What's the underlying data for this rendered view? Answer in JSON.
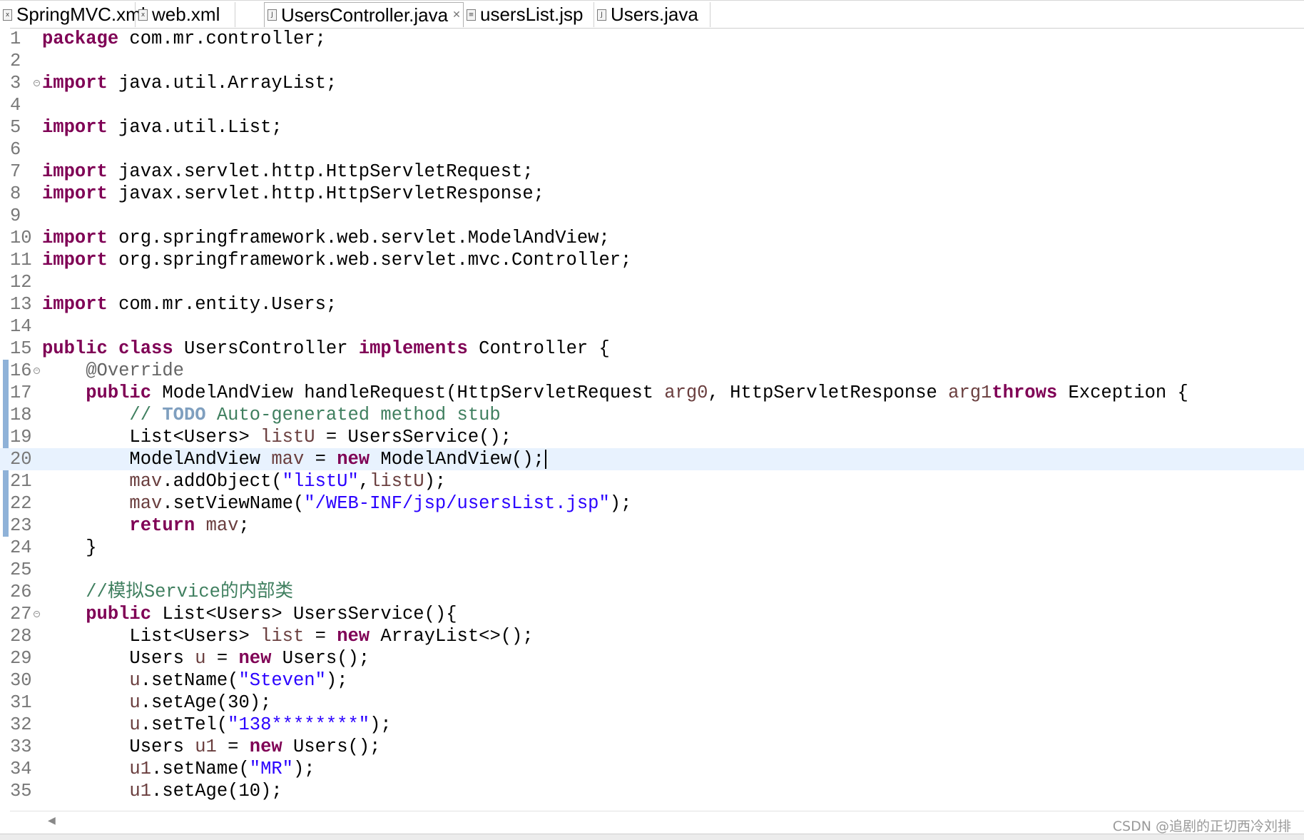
{
  "tabs": [
    {
      "label": "SpringMVC.xml",
      "icon": "xml-file-icon",
      "glyph": "x",
      "active": false
    },
    {
      "label": "web.xml",
      "icon": "xml-file-icon",
      "glyph": "x",
      "active": false
    },
    {
      "label": "UsersController.java",
      "icon": "java-file-icon",
      "glyph": "J",
      "active": true,
      "close": "✕"
    },
    {
      "label": "usersList.jsp",
      "icon": "jsp-file-icon",
      "glyph": "≡",
      "active": false
    },
    {
      "label": "Users.java",
      "icon": "java-file-icon",
      "glyph": "J",
      "active": false
    }
  ],
  "editor": {
    "current_line": 20,
    "lines": [
      {
        "n": "1",
        "tokens": [
          [
            "kw",
            "package"
          ],
          [
            "",
            "com.mr.controller;"
          ]
        ]
      },
      {
        "n": "2",
        "tokens": []
      },
      {
        "n": "3",
        "fold": true,
        "tokens": [
          [
            "kw",
            "import"
          ],
          [
            "",
            " java.util.ArrayList;"
          ]
        ]
      },
      {
        "n": "4",
        "tokens": []
      },
      {
        "n": "5",
        "tokens": [
          [
            "kw",
            "import"
          ],
          [
            "",
            " java.util.List;"
          ]
        ]
      },
      {
        "n": "6",
        "tokens": []
      },
      {
        "n": "7",
        "tokens": [
          [
            "kw",
            "import"
          ],
          [
            "",
            " javax.servlet.http.HttpServletRequest;"
          ]
        ]
      },
      {
        "n": "8",
        "tokens": [
          [
            "kw",
            "import"
          ],
          [
            "",
            " javax.servlet.http.HttpServletResponse;"
          ]
        ]
      },
      {
        "n": "9",
        "tokens": []
      },
      {
        "n": "10",
        "tokens": [
          [
            "kw",
            "import"
          ],
          [
            "",
            " org.springframework.web.servlet.ModelAndView;"
          ]
        ]
      },
      {
        "n": "11",
        "tokens": [
          [
            "kw",
            "import"
          ],
          [
            "",
            " org.springframework.web.servlet.mvc.Controller;"
          ]
        ]
      },
      {
        "n": "12",
        "tokens": []
      },
      {
        "n": "13",
        "tokens": [
          [
            "kw",
            "import"
          ],
          [
            "",
            " com.mr.entity.Users;"
          ]
        ]
      },
      {
        "n": "14",
        "tokens": []
      },
      {
        "n": "15",
        "tokens": [
          [
            "kw",
            "public"
          ],
          [
            "",
            " "
          ],
          [
            "kw",
            "class"
          ],
          [
            "",
            " UsersController "
          ],
          [
            "kw",
            "implements"
          ],
          [
            "",
            " Controller {"
          ]
        ]
      },
      {
        "n": "16",
        "fold": true,
        "tokens": [
          [
            "",
            "    "
          ],
          [
            "ann",
            "@Override"
          ]
        ]
      },
      {
        "n": "17",
        "tokens": [
          [
            "",
            "    "
          ],
          [
            "kw",
            "public"
          ],
          [
            "",
            " ModelAndView handleRequest(HttpServletRequest "
          ],
          [
            "var",
            "arg0"
          ],
          [
            "",
            ", HttpServletResponse "
          ],
          [
            "var",
            "arg1"
          ],
          [
            ") "
          ],
          [
            "kw",
            "throws"
          ],
          [
            "",
            " Exception {"
          ]
        ]
      },
      {
        "n": "18",
        "tokens": [
          [
            "",
            "        "
          ],
          [
            "cm",
            "// "
          ],
          [
            "todo",
            "TODO"
          ],
          [
            "cm",
            " Auto-generated method stub"
          ]
        ]
      },
      {
        "n": "19",
        "tokens": [
          [
            "",
            "        List<Users> "
          ],
          [
            "var",
            "listU"
          ],
          [
            "",
            " = UsersService();"
          ]
        ]
      },
      {
        "n": "20",
        "tokens": [
          [
            "",
            "        ModelAndView "
          ],
          [
            "var",
            "mav"
          ],
          [
            "",
            " = "
          ],
          [
            "kw",
            "new"
          ],
          [
            "",
            " ModelAndView();"
          ]
        ]
      },
      {
        "n": "21",
        "tokens": [
          [
            "",
            "        "
          ],
          [
            "var",
            "mav"
          ],
          [
            "",
            ".addObject("
          ],
          [
            "str",
            "\"listU\""
          ],
          [
            "",
            ","
          ],
          [
            "var",
            "listU"
          ],
          [
            "",
            ");"
          ]
        ]
      },
      {
        "n": "22",
        "tokens": [
          [
            "",
            "        "
          ],
          [
            "var",
            "mav"
          ],
          [
            "",
            ".setViewName("
          ],
          [
            "str",
            "\"/WEB-INF/jsp/usersList.jsp\""
          ],
          [
            "",
            ");"
          ]
        ]
      },
      {
        "n": "23",
        "tokens": [
          [
            "",
            "        "
          ],
          [
            "kw",
            "return"
          ],
          [
            "",
            " "
          ],
          [
            "var",
            "mav"
          ],
          [
            "",
            ";"
          ]
        ]
      },
      {
        "n": "24",
        "tokens": [
          [
            "",
            "    }"
          ]
        ]
      },
      {
        "n": "25",
        "tokens": []
      },
      {
        "n": "26",
        "tokens": [
          [
            "",
            "    "
          ],
          [
            "cm",
            "//模拟Service的内部类"
          ]
        ]
      },
      {
        "n": "27",
        "fold": true,
        "tokens": [
          [
            "",
            "    "
          ],
          [
            "kw",
            "public"
          ],
          [
            "",
            " List<Users> UsersService(){"
          ]
        ]
      },
      {
        "n": "28",
        "tokens": [
          [
            "",
            "        List<Users> "
          ],
          [
            "var",
            "list"
          ],
          [
            "",
            " = "
          ],
          [
            "kw",
            "new"
          ],
          [
            "",
            " ArrayList<>();"
          ]
        ]
      },
      {
        "n": "29",
        "tokens": [
          [
            "",
            "        Users "
          ],
          [
            "var",
            "u"
          ],
          [
            "",
            " = "
          ],
          [
            "kw",
            "new"
          ],
          [
            "",
            " Users();"
          ]
        ]
      },
      {
        "n": "30",
        "tokens": [
          [
            "",
            "        "
          ],
          [
            "var",
            "u"
          ],
          [
            "",
            ".setName("
          ],
          [
            "str",
            "\"Steven\""
          ],
          [
            "",
            ");"
          ]
        ]
      },
      {
        "n": "31",
        "tokens": [
          [
            "",
            "        "
          ],
          [
            "var",
            "u"
          ],
          [
            "",
            ".setAge(30);"
          ]
        ]
      },
      {
        "n": "32",
        "tokens": [
          [
            "",
            "        "
          ],
          [
            "var",
            "u"
          ],
          [
            "",
            ".setTel("
          ],
          [
            "str",
            "\"138********\""
          ],
          [
            "",
            ");"
          ]
        ]
      },
      {
        "n": "33",
        "tokens": [
          [
            "",
            "        Users "
          ],
          [
            "var",
            "u1"
          ],
          [
            "",
            " = "
          ],
          [
            "kw",
            "new"
          ],
          [
            "",
            " Users();"
          ]
        ]
      },
      {
        "n": "34",
        "tokens": [
          [
            "",
            "        "
          ],
          [
            "var",
            "u1"
          ],
          [
            "",
            ".setName("
          ],
          [
            "str",
            "\"MR\""
          ],
          [
            "",
            ");"
          ]
        ]
      },
      {
        "n": "35",
        "tokens": [
          [
            "",
            "        "
          ],
          [
            "var",
            "u1"
          ],
          [
            "",
            ".setAge(10);"
          ]
        ]
      }
    ]
  },
  "scrollbar_arrow": "◀",
  "watermark": "CSDN @追剧的正切西冷刘排"
}
